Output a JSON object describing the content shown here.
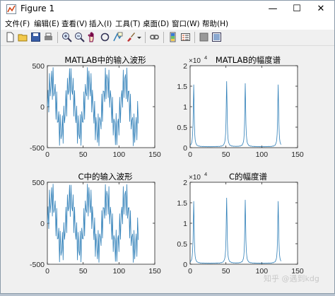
{
  "window": {
    "title": "Figure 1"
  },
  "window_buttons": {
    "minimize": "—",
    "maximize": "☐",
    "close": "✕"
  },
  "menu": [
    "文件(F)",
    "编辑(E)",
    "查看(V)",
    "插入(I)",
    "工具(T)",
    "桌面(D)",
    "窗口(W)",
    "帮助(H)"
  ],
  "toolbar": [
    "new-file-icon",
    "open-folder-icon",
    "save-icon",
    "print-icon",
    "zoom-in-icon",
    "zoom-out-icon",
    "pan-hand-icon",
    "rotate-3d-icon",
    "data-cursor-icon",
    "brush-icon",
    "brush-dropdown-icon",
    "link-plot-icon",
    "insert-colorbar-icon",
    "insert-legend-icon",
    "hide-plot-tools-icon",
    "show-plot-tools-icon"
  ],
  "colors": {
    "line": "#2f7fb8",
    "axes_bg": "#ffffff",
    "figure_bg": "#f0f0f0"
  },
  "chart_data": [
    {
      "type": "line",
      "title": "MATLAB中的输入波形",
      "xlim": [
        0,
        130
      ],
      "ylim": [
        -500,
        500
      ],
      "xticks": [
        "0",
        "50",
        "100",
        "150"
      ],
      "yticks": [
        "500",
        "0",
        "-500"
      ],
      "series": [
        {
          "signal": "sum of sinusoids, periodic ~26 samples",
          "points": 128
        }
      ]
    },
    {
      "type": "line",
      "title": "MATLAB的幅度谱",
      "exponent_label": "×10",
      "exponent_power": "4",
      "xlim": [
        0,
        130
      ],
      "ylim": [
        0,
        2
      ],
      "xticks": [
        "0",
        "50",
        "100",
        "150"
      ],
      "yticks": [
        "2",
        "1.5",
        "1",
        "0.5",
        "0"
      ],
      "peaks": [
        {
          "x": 5,
          "y": 1.52
        },
        {
          "x": 51,
          "y": 1.6
        },
        {
          "x": 77,
          "y": 1.55
        },
        {
          "x": 123,
          "y": 1.52
        }
      ]
    },
    {
      "type": "line",
      "title": "C中的输入波形",
      "xlim": [
        0,
        130
      ],
      "ylim": [
        -500,
        500
      ],
      "xticks": [
        "0",
        "50",
        "100",
        "150"
      ],
      "yticks": [
        "500",
        "0",
        "-500"
      ],
      "series": [
        {
          "signal": "sum of sinusoids, periodic ~26 samples",
          "points": 128
        }
      ]
    },
    {
      "type": "line",
      "title": "C的幅度谱",
      "exponent_label": "×10",
      "exponent_power": "4",
      "xlim": [
        0,
        130
      ],
      "ylim": [
        0,
        2
      ],
      "xticks": [
        "0",
        "50",
        "100",
        "150"
      ],
      "yticks": [
        "2",
        "1.5",
        "1",
        "0.5",
        "0"
      ],
      "peaks": [
        {
          "x": 5,
          "y": 1.52
        },
        {
          "x": 51,
          "y": 1.6
        },
        {
          "x": 77,
          "y": 1.55
        },
        {
          "x": 123,
          "y": 1.52
        }
      ]
    }
  ],
  "watermark": "知乎 @遇到kdg"
}
